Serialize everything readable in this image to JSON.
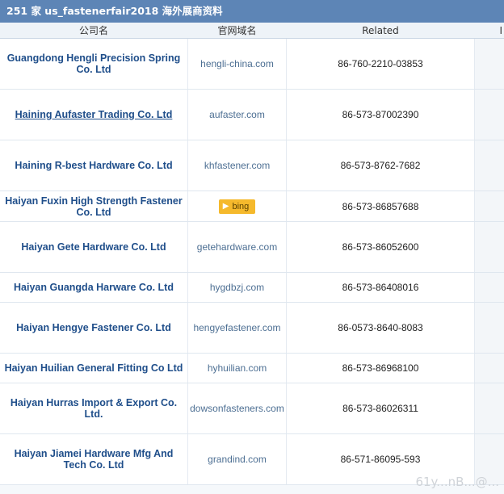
{
  "title": "251 家 us_fastenerfair2018 海外展商资料",
  "header": {
    "company_label": "公司名",
    "domain_label": "官网域名",
    "related_label": "Related",
    "extra_label": "I"
  },
  "rows": [
    {
      "company": "Guangdong Hengli Precision Spring Co. Ltd",
      "domain": "hengli-china.com",
      "phone": "86-760-2210-03853"
    },
    {
      "company": "Haining Aufaster Trading Co. Ltd",
      "domain": "aufaster.com",
      "phone": "86-573-87002390",
      "hovered": true
    },
    {
      "company": "Haining R-best Hardware Co. Ltd",
      "domain": "khfastener.com",
      "phone": "86-573-8762-7682"
    },
    {
      "company": "Haiyan Fuxin High Strength Fastener Co. Ltd",
      "domain": "",
      "badge": "bing",
      "badge_icon": "bing-icon",
      "phone": "86-573-86857688"
    },
    {
      "company": "Haiyan Gete Hardware Co. Ltd",
      "domain": "getehardware.com",
      "phone": "86-573-86052600"
    },
    {
      "company": "Haiyan Guangda Harware Co. Ltd",
      "domain": "hygdbzj.com",
      "phone": "86-573-86408016"
    },
    {
      "company": "Haiyan Hengye Fastener Co. Ltd",
      "domain": "hengyefastener.com",
      "phone": "86-0573-8640-8083"
    },
    {
      "company": "Haiyan Huilian General Fitting Co Ltd",
      "domain": "hyhuilian.com",
      "phone": "86-573-86968100"
    },
    {
      "company": "Haiyan Hurras Import & Export Co. Ltd.",
      "domain": "dowsonfasteners.com",
      "phone": "86-573-86026311"
    },
    {
      "company": "Haiyan Jiamei Hardware Mfg And Tech Co. Ltd",
      "domain": "grandind.com",
      "phone": "86-571-86095-593"
    }
  ],
  "watermark": "61y...nB...@..."
}
